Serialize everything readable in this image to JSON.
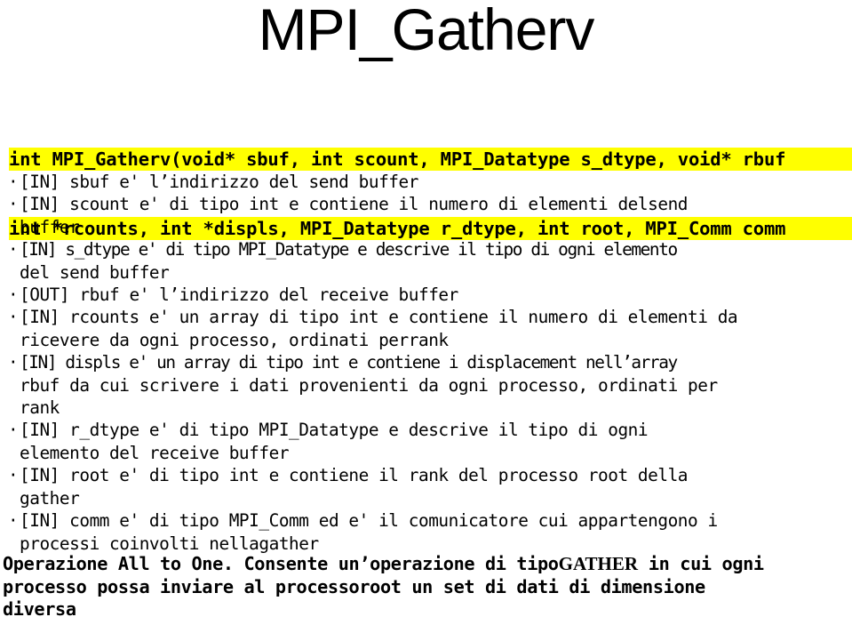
{
  "slide": {
    "title": "MPI_Gatherv",
    "background_color": "#ffffff",
    "text_color": "#000000",
    "highlight_color": "#ffff00"
  },
  "signature": {
    "line1": "int MPI_Gatherv(void* sbuf, int scount, MPI_Datatype s_dtype, void* rbuf",
    "line2": "int *rcounts, int *displs, MPI_Datatype r_dtype, int root, MPI_Comm comm"
  },
  "bullets": [
    {
      "marker": "·",
      "lines": [
        "[IN] sbuf e' l’indirizzo del send buffer"
      ]
    },
    {
      "marker": "·",
      "lines": [
        "[IN] scount e' di tipo int e contiene il numero di elementi delsend",
        "buffer"
      ]
    },
    {
      "marker": "·",
      "lines": [
        "[IN] s_dtype e' di tipo MPI_Datatype e descrive il tipo di ogni elemento",
        "del send buffer"
      ]
    },
    {
      "marker": "·",
      "lines": [
        "[OUT] rbuf e' l’indirizzo del receive buffer"
      ]
    },
    {
      "marker": "·",
      "lines": [
        "[IN] rcounts e' un array di tipo int e contiene il numero di elementi da",
        "ricevere da ogni processo, ordinati perrank"
      ]
    },
    {
      "marker": "·",
      "lines": [
        "[IN] displs e' un array di tipo int e contiene i displacement nell’array",
        "rbuf da cui scrivere i dati provenienti da ogni processo, ordinati per",
        "rank"
      ]
    },
    {
      "marker": "·",
      "lines": [
        "[IN] r_dtype e' di tipo MPI_Datatype e descrive il tipo di ogni",
        "elemento del receive buffer"
      ]
    },
    {
      "marker": "·",
      "lines": [
        "[IN] root e' di tipo int e contiene il rank del processo root della",
        "gather"
      ]
    },
    {
      "marker": "·",
      "lines": [
        "[IN] comm e' di tipo MPI_Comm ed e' il comunicatore cui appartengono i",
        "processi coinvolti nellagather"
      ]
    }
  ],
  "footer": {
    "line1_part1": "Operazione All to One. Consente un’operazione di tipo",
    "line1_emphasis": "GATHER",
    "line1_part2": " in cui ogni",
    "line2": "processo possa inviare al processoroot un set di dati di dimensione",
    "line3": "diversa"
  }
}
